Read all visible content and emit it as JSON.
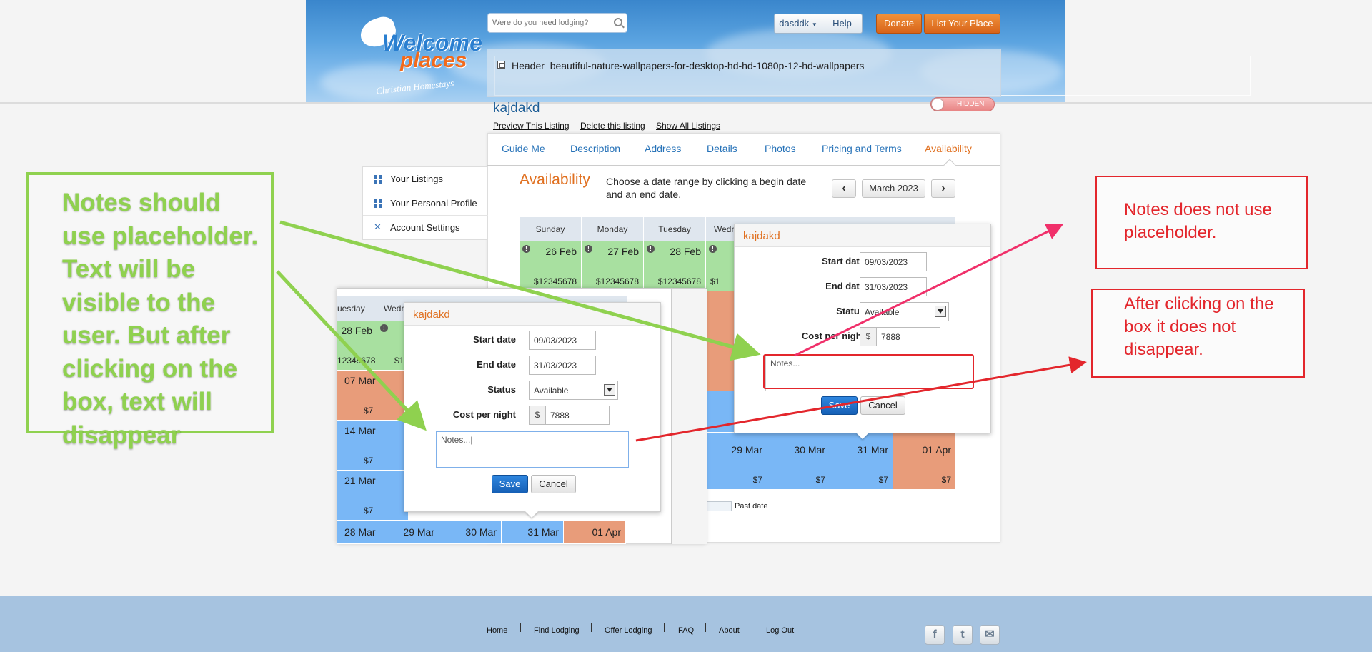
{
  "header": {
    "search_placeholder": "Were do you need lodging?",
    "user_menu": "dasddk",
    "help": "Help",
    "donate": "Donate",
    "list_place": "List Your Place",
    "logo_line1": "Welcome",
    "logo_line2": "places",
    "logo_tagline": "Christian Homestays",
    "image_alt": "Header_beautiful-nature-wallpapers-for-desktop-hd-hd-1080p-12-hd-wallpapers",
    "visibility_toggle": "HIDDEN"
  },
  "listing": {
    "title": "kajdakd",
    "links": [
      "Preview This Listing",
      "Delete this listing",
      "Show All Listings"
    ]
  },
  "tabs": [
    "Guide Me",
    "Description",
    "Address",
    "Details",
    "Photos",
    "Pricing and Terms",
    "Availability"
  ],
  "active_tab": "Availability",
  "sidebar": [
    "Your Listings",
    "Your Personal Profile",
    "Account Settings"
  ],
  "availability": {
    "title": "Availability",
    "description": "Choose a date range by clicking a begin date and an end date.",
    "month": "March 2023",
    "prev": "‹",
    "next": "›",
    "legend_past": "Past date"
  },
  "calendar_main": {
    "headers": [
      "Sunday",
      "Monday",
      "Tuesday",
      "Wedn"
    ],
    "row1": [
      {
        "date": "26 Feb",
        "price": "$12345678"
      },
      {
        "date": "27 Feb",
        "price": "$12345678"
      },
      {
        "date": "28 Feb",
        "price": "$12345678"
      },
      {
        "date": "",
        "price": "$1"
      }
    ],
    "last_row": [
      {
        "date": "29 Mar",
        "price": "$7"
      },
      {
        "date": "30 Mar",
        "price": "$7"
      },
      {
        "date": "31 Mar",
        "price": "$7"
      },
      {
        "date": "01 Apr",
        "price": "$7"
      }
    ]
  },
  "calendar_overlay": {
    "headers": [
      "uesday",
      "Wedn"
    ],
    "rows": [
      {
        "date": "28 Feb",
        "price": "12345678"
      },
      {
        "date": "07 Mar",
        "price": "$7"
      },
      {
        "date": "14 Mar",
        "price": "$7"
      },
      {
        "date": "21 Mar",
        "price": "$7"
      }
    ],
    "wed_price": "$1",
    "bottom_row": [
      "28 Mar",
      "29 Mar",
      "30 Mar",
      "31 Mar",
      "01 Apr"
    ]
  },
  "popup_right": {
    "title": "kajdakd",
    "start_label": "Start date",
    "start_value": "09/03/2023",
    "end_label": "End date",
    "end_value": "31/03/2023",
    "status_label": "Status",
    "status_value": "Available",
    "cost_label": "Cost per night",
    "currency": "$",
    "cost_value": "7888",
    "notes": "Notes...",
    "save": "Save",
    "cancel": "Cancel"
  },
  "popup_left": {
    "title": "kajdakd",
    "start_label": "Start date",
    "start_value": "09/03/2023",
    "end_label": "End date",
    "end_value": "31/03/2023",
    "status_label": "Status",
    "status_value": "Available",
    "cost_label": "Cost per night",
    "currency": "$",
    "cost_value": "7888",
    "notes": "Notes...|",
    "save": "Save",
    "cancel": "Cancel"
  },
  "annotations": {
    "green": "Notes should use placeholder. Text will be visible to the user. But after clicking on the box, text will disappear",
    "red1": "Notes does not use placeholder.",
    "red2": "After clicking on the box it does not disappear."
  },
  "footer": {
    "links": [
      "Home",
      "Find Lodging",
      "Offer Lodging",
      "FAQ",
      "About",
      "Log Out"
    ],
    "social": [
      "f",
      "t",
      "✉"
    ]
  },
  "colors": {
    "accent_orange": "#e07020",
    "link_blue": "#2672b8",
    "annotation_green": "#8fd14f",
    "annotation_red": "#e3262c",
    "cal_green": "#a8e0a0",
    "cal_orange": "#e89c7a",
    "cal_blue": "#79b7f6"
  }
}
